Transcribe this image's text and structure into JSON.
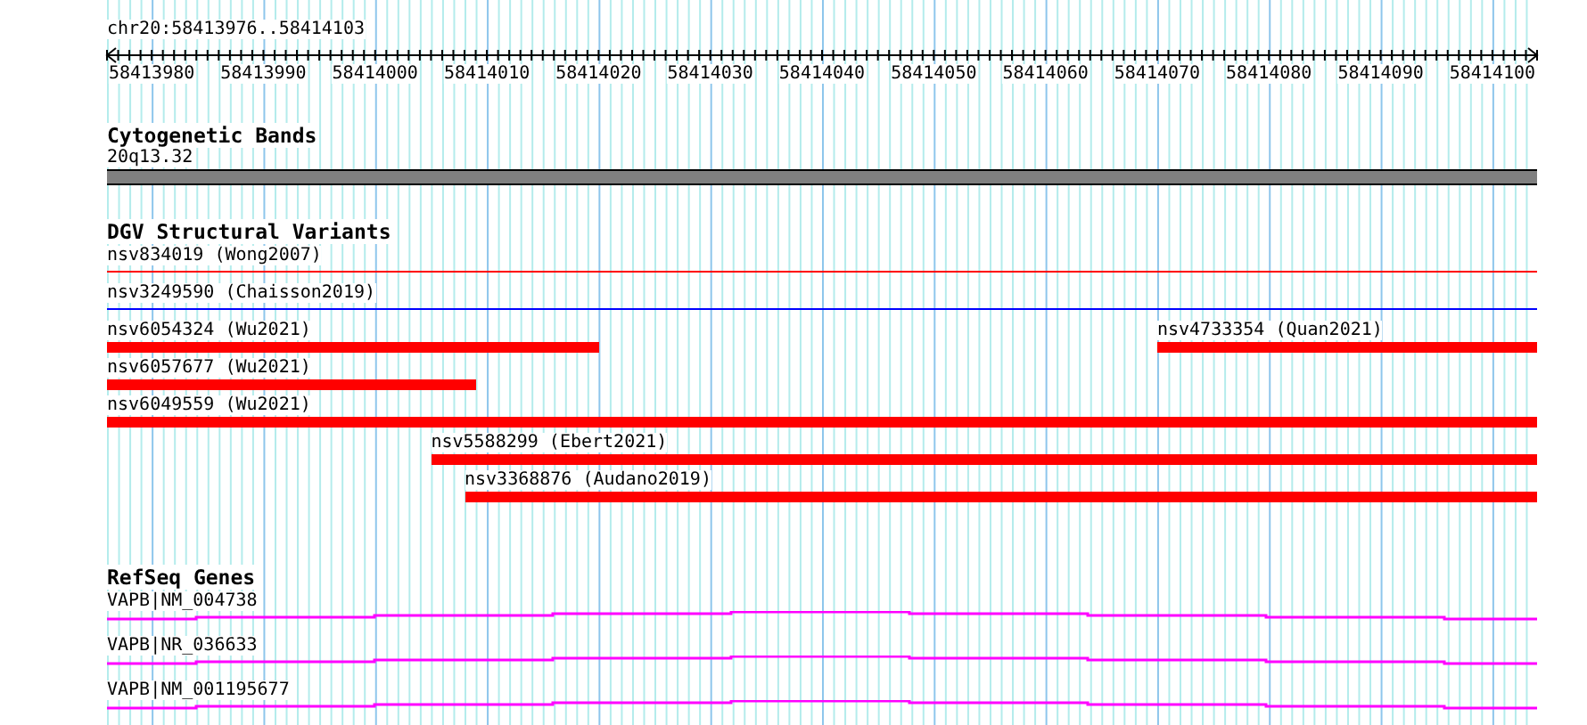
{
  "view": {
    "label": "chr20:58413976..58414103"
  },
  "ruler": {
    "tick_labels": [
      "58413980",
      "58413990",
      "58414000",
      "58414010",
      "58414020",
      "58414030",
      "58414040",
      "58414050",
      "58414060",
      "58414070",
      "58414080",
      "58414090",
      "58414100"
    ]
  },
  "cytogenetic_bands": {
    "title": "Cytogenetic Bands",
    "band": "20q13.32"
  },
  "dgv": {
    "title": "DGV Structural Variants",
    "rows": [
      {
        "features": [
          {
            "label": "nsv834019 (Wong2007)",
            "kind": "line",
            "color": "#ff0000"
          }
        ]
      },
      {
        "features": [
          {
            "label": "nsv3249590 (Chaisson2019)",
            "kind": "line",
            "color": "#0000ff"
          }
        ]
      },
      {
        "features": [
          {
            "label": "nsv6054324 (Wu2021)",
            "kind": "bar",
            "color": "#ff0000"
          },
          {
            "label": "nsv4733354 (Quan2021)",
            "kind": "bar",
            "color": "#ff0000"
          }
        ]
      },
      {
        "features": [
          {
            "label": "nsv6057677 (Wu2021)",
            "kind": "bar",
            "color": "#ff0000"
          }
        ]
      },
      {
        "features": [
          {
            "label": "nsv6049559 (Wu2021)",
            "kind": "bar",
            "color": "#ff0000"
          }
        ]
      },
      {
        "features": [
          {
            "label": "nsv5588299 (Ebert2021)",
            "kind": "bar",
            "color": "#ff0000"
          }
        ]
      },
      {
        "features": [
          {
            "label": "nsv3368876 (Audano2019)",
            "kind": "bar",
            "color": "#ff0000"
          }
        ]
      }
    ]
  },
  "refseq": {
    "title": "RefSeq Genes",
    "genes": [
      {
        "label": "VAPB|NM_004738"
      },
      {
        "label": "VAPB|NR_036633"
      },
      {
        "label": "VAPB|NM_001195677"
      }
    ]
  }
}
